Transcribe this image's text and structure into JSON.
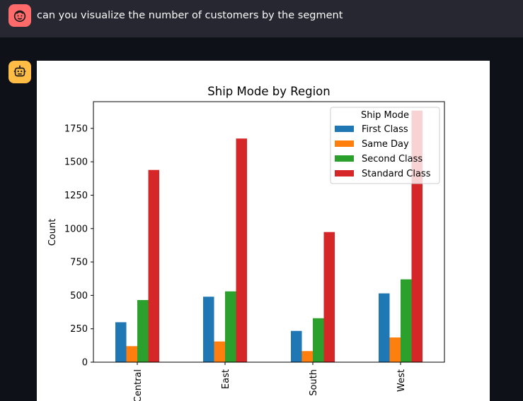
{
  "user_message": {
    "text": "can you visualize the number of customers by the segment",
    "avatar_icon": "smiling-face-icon"
  },
  "assistant": {
    "avatar_icon": "robot-icon"
  },
  "colors": {
    "page_bg": "#0e1117",
    "user_bar_bg": "#262730",
    "user_avatar": "#ff6b6b",
    "bot_avatar": "#ffbd45"
  },
  "chart_data": {
    "type": "bar",
    "title": "Ship Mode by Region",
    "xlabel": "",
    "ylabel": "Count",
    "ylim": [
      0,
      1950
    ],
    "yticks": [
      0,
      250,
      500,
      750,
      1000,
      1250,
      1500,
      1750
    ],
    "categories": [
      "Central",
      "East",
      "South",
      "West"
    ],
    "grid": false,
    "legend": {
      "title": "Ship Mode",
      "placement": "top-right"
    },
    "series": [
      {
        "name": "First Class",
        "color": "#1f77b4",
        "values": [
          299,
          490,
          234,
          515
        ]
      },
      {
        "name": "Same Day",
        "color": "#ff7f0e",
        "values": [
          120,
          155,
          83,
          185
        ]
      },
      {
        "name": "Second Class",
        "color": "#2ca02c",
        "values": [
          465,
          530,
          329,
          620
        ]
      },
      {
        "name": "Standard Class",
        "color": "#d62728",
        "values": [
          1439,
          1674,
          974,
          1883
        ]
      }
    ]
  }
}
